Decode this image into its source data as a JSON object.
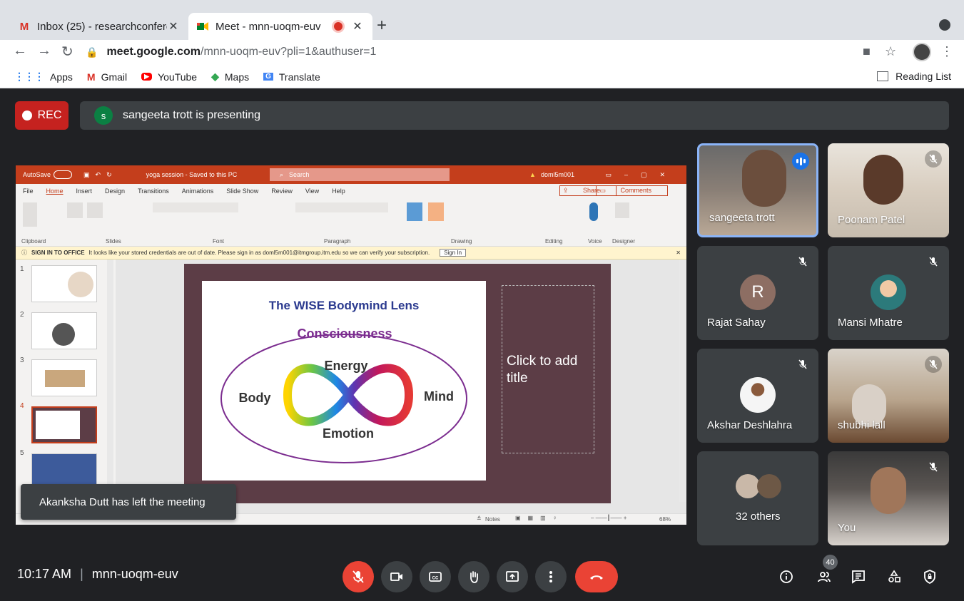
{
  "browser": {
    "tabs": [
      {
        "label": "Inbox (25) - researchconferenc",
        "icon": "gmail-icon"
      },
      {
        "label": "Meet - mnn-uoqm-euv",
        "icon": "meet-icon"
      }
    ],
    "url_host": "meet.google.com",
    "url_path": "/mnn-uoqm-euv?pli=1&authuser=1",
    "bookmarks": [
      "Apps",
      "Gmail",
      "YouTube",
      "Maps",
      "Translate"
    ],
    "reading_list": "Reading List"
  },
  "meet": {
    "rec_label": "REC",
    "presenter_initial": "s",
    "presenting_text": "sangeeta trott is presenting",
    "toast": "Akanksha Dutt has left the meeting",
    "time": "10:17 AM",
    "meeting_code": "mnn-uoqm-euv",
    "participant_count": "40",
    "participants": [
      {
        "name": "sangeeta trott",
        "speaking": true
      },
      {
        "name": "Poonam Patel",
        "muted": true
      },
      {
        "name": "Rajat Sahay",
        "initial": "R",
        "muted": true
      },
      {
        "name": "Mansi Mhatre",
        "muted": true
      },
      {
        "name": "Akshar Deshlahra",
        "muted": true
      },
      {
        "name": "shubhi lall",
        "muted": true
      },
      {
        "name": "32 others"
      },
      {
        "name": "You",
        "muted": true
      }
    ]
  },
  "ppt": {
    "autosave": "AutoSave",
    "autosave_state": "Off",
    "doc_title": "yoga session - Saved to this PC",
    "search": "Search",
    "user": "doml5m001",
    "menu": [
      "File",
      "Home",
      "Insert",
      "Design",
      "Transitions",
      "Animations",
      "Slide Show",
      "Review",
      "View",
      "Help"
    ],
    "share": "Share",
    "comments": "Comments",
    "ribbon_groups": [
      "Clipboard",
      "Slides",
      "Font",
      "Paragraph",
      "Drawing",
      "Editing",
      "Voice",
      "Designer"
    ],
    "notice_title": "SIGN IN TO OFFICE",
    "notice_text": "It looks like your stored credentials are out of date. Please sign in as doml5m001@itmgroup.itm.edu so we can verify your subscription.",
    "notice_button": "Sign In",
    "slide": {
      "title": "The WISE Bodymind Lens",
      "top": "Consciousness",
      "energy": "Energy",
      "body": "Body",
      "mind": "Mind",
      "emotion": "Emotion"
    },
    "placeholder": "Click to add title",
    "thumb_numbers": [
      "1",
      "2",
      "3",
      "4",
      "5"
    ],
    "notes": "Notes",
    "zoom": "68%"
  }
}
